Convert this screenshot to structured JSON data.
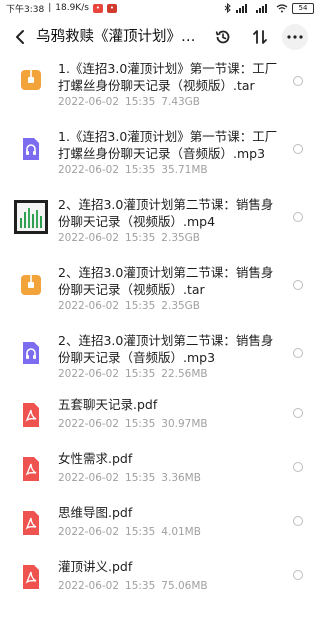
{
  "status_bar": {
    "time": "下午3:38",
    "speed": "18.9K/s",
    "battery": "54"
  },
  "header": {
    "title": "乌鸦救赎《灌顶计划》更..."
  },
  "files": [
    {
      "name": "1.《连招3.0灌顶计划》第一节课：工厂打螺丝身份聊天记录（视频版）.tar",
      "date": "2022-06-02",
      "time": "15:35",
      "size": "7.43GB",
      "icon": "archive-icon",
      "color": "#f2a33a"
    },
    {
      "name": "1.《连招3.0灌顶计划》第一节课：工厂打螺丝身份聊天记录（音频版）.mp3",
      "date": "2022-06-02",
      "time": "15:35",
      "size": "35.71MB",
      "icon": "audio-icon",
      "color": "#7b6cf0"
    },
    {
      "name": "2、连招3.0灌顶计划第二节课：销售身份聊天记录（视频版）.mp4",
      "date": "2022-06-02",
      "time": "15:35",
      "size": "2.35GB",
      "icon": "video-thumbnail-icon",
      "color": "#2e9e4f"
    },
    {
      "name": "2、连招3.0灌顶计划第二节课：销售身份聊天记录（视频版）.tar",
      "date": "2022-06-02",
      "time": "15:35",
      "size": "2.35GB",
      "icon": "archive-icon",
      "color": "#f2a33a"
    },
    {
      "name": "2、连招3.0灌顶计划第二节课：销售身份聊天记录（音频版）.mp3",
      "date": "2022-06-02",
      "time": "15:35",
      "size": "22.56MB",
      "icon": "audio-icon",
      "color": "#7b6cf0"
    },
    {
      "name": "五套聊天记录.pdf",
      "date": "2022-06-02",
      "time": "15:35",
      "size": "30.97MB",
      "icon": "pdf-icon",
      "color": "#ef5350"
    },
    {
      "name": "女性需求.pdf",
      "date": "2022-06-02",
      "time": "15:35",
      "size": "3.36MB",
      "icon": "pdf-icon",
      "color": "#ef5350"
    },
    {
      "name": "思维导图.pdf",
      "date": "2022-06-02",
      "time": "15:35",
      "size": "4.01MB",
      "icon": "pdf-icon",
      "color": "#ef5350"
    },
    {
      "name": "灌顶讲义.pdf",
      "date": "2022-06-02",
      "time": "15:35",
      "size": "75.06MB",
      "icon": "pdf-icon",
      "color": "#ef5350"
    }
  ],
  "icons": {
    "back": "chevron-left-icon",
    "history": "history-icon",
    "sort": "sort-icon",
    "more": "more-icon"
  }
}
